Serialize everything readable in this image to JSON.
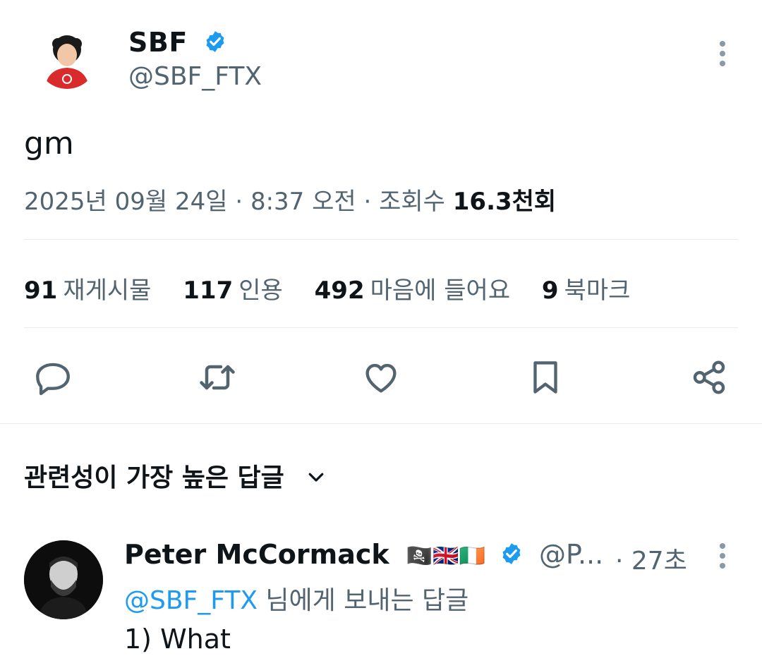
{
  "tweet": {
    "author_name": "SBF",
    "author_handle": "@SBF_FTX",
    "verified_icon": "verified-badge-icon",
    "text": "gm",
    "date": "2025년 09월 24일",
    "time": "8:37 오전",
    "views_label": "조회수",
    "views_value": "16.3천회",
    "sep": "·"
  },
  "stats": [
    {
      "num": "91",
      "label": "재게시물"
    },
    {
      "num": "117",
      "label": "인용"
    },
    {
      "num": "492",
      "label": "마음에 들어요"
    },
    {
      "num": "9",
      "label": "북마크"
    }
  ],
  "actions": [
    {
      "name": "reply",
      "icon": "reply-icon"
    },
    {
      "name": "retweet",
      "icon": "retweet-icon"
    },
    {
      "name": "like",
      "icon": "heart-icon"
    },
    {
      "name": "bookmark",
      "icon": "bookmark-icon"
    },
    {
      "name": "share",
      "icon": "share-icon"
    }
  ],
  "replies": {
    "sort_label": "관련성이 가장 높은 답글",
    "items": [
      {
        "name": "Peter McCormack",
        "flags": "🏴‍☠️🇬🇧🇮🇪",
        "handle": "@P...",
        "time": "· 27초",
        "replying_mention": "@SBF_FTX",
        "replying_suffix": " 님에게 보내는 답글",
        "text": "1) What"
      }
    ]
  },
  "colors": {
    "accent": "#1d9bf0",
    "secondary_text": "#536471",
    "primary_text": "#0f1419",
    "divider": "#e6ecf0"
  }
}
